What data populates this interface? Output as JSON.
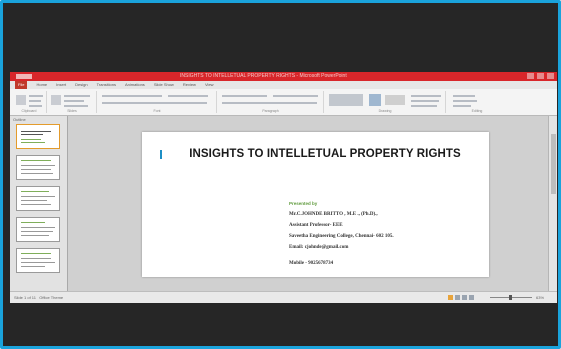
{
  "window": {
    "title": "INSIGHTS TO INTELLETUAL PROPERTY RIGHTS - Microsoft PowerPoint"
  },
  "ribbon_tabs": [
    "File",
    "Home",
    "Insert",
    "Design",
    "Transitions",
    "Animations",
    "Slide Show",
    "Review",
    "View"
  ],
  "ribbon_groups": [
    "Clipboard",
    "Slides",
    "Font",
    "Paragraph",
    "Drawing",
    "Editing"
  ],
  "panel": {
    "title": "Outline"
  },
  "slide": {
    "title": "INSIGHTS TO INTELLETUAL PROPERTY RIGHTS",
    "presented_by": "Presented by",
    "lines": [
      "Mr.C.JOHNDE BRITTO , M.E ., (Ph.D).,",
      "Assistant Professor- EEE",
      "Saveetha Engineering College, Chennai- 602 105.",
      "Email: cjohnde@gmail.com",
      "Mobile - 9025678734"
    ]
  },
  "status": {
    "slide_info": "Slide 1 of 11",
    "theme": "Office Theme",
    "zoom": "63%"
  },
  "colors": {
    "frame_border": "#1aa3dc",
    "titlebar": "#d8262a",
    "accent_bar": "#1e8fc5"
  }
}
